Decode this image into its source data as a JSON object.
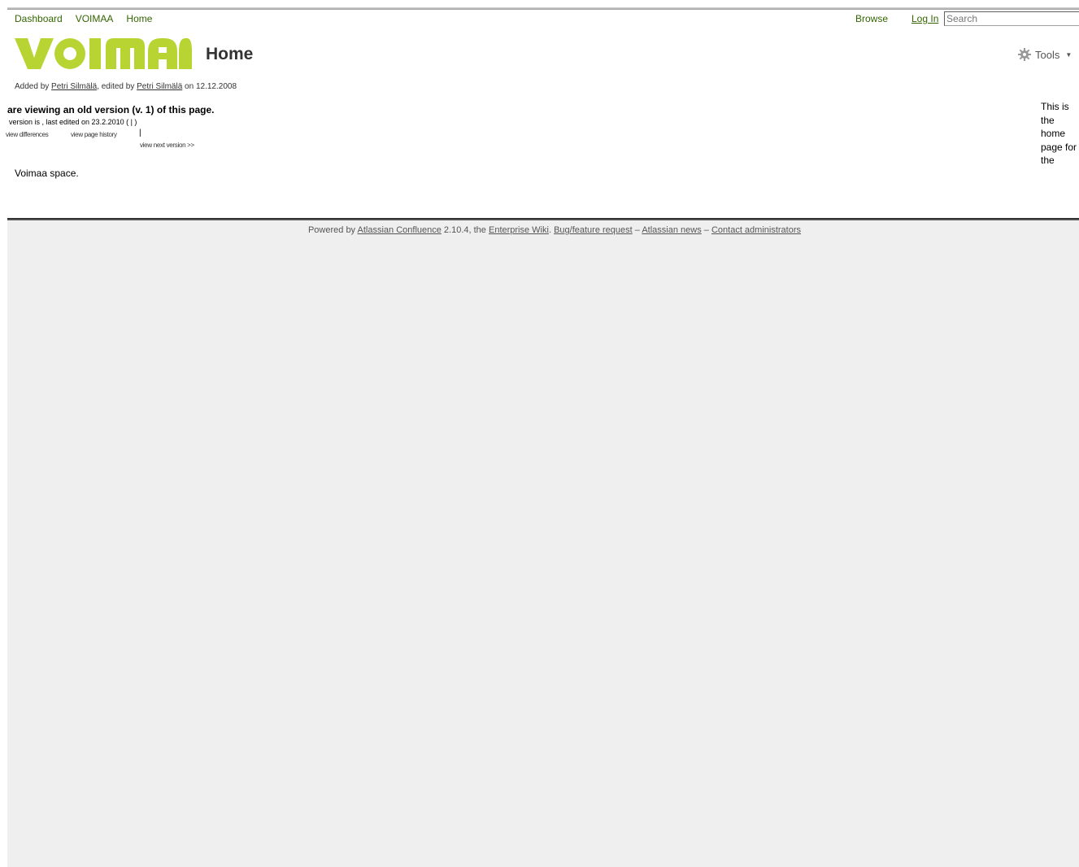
{
  "header": {
    "breadcrumbs": [
      "Dashboard",
      "VOIMAA",
      "Home"
    ],
    "browse_label": "Browse",
    "login_label": "Log In",
    "search_placeholder": "Search"
  },
  "logo": {
    "text": "VOIMAA",
    "color": "#b8d432"
  },
  "page": {
    "title": "Home",
    "tools_label": "Tools",
    "meta": {
      "added_by_prefix": "Added by",
      "added_by": "Petri Silmälä",
      "edited_by_prefix": ", edited by",
      "edited_by": "Petri Silmälä",
      "date_prefix": "on",
      "date": "12.12.2008"
    },
    "old_version": {
      "heading": "are viewing an old version (v. 1) of this page.",
      "version_line": "version is , last edited on 23.2.2010 ( | )",
      "view_differences": "view differences",
      "view_history": "view page history",
      "separator": "|",
      "view_next": "view next version >>"
    },
    "body_text": "Voimaa space.",
    "side_text": "This is the home page for the"
  },
  "footer": {
    "powered_by": "Powered by",
    "confluence_link": "Atlassian Confluence",
    "version": "2.10.4, the",
    "enterprise_link": "Enterprise Wiki",
    "bug_link": "Bug/feature request",
    "dash1": "–",
    "news_link": "Atlassian news",
    "dash2": "–",
    "contact_link": "Contact administrators"
  }
}
